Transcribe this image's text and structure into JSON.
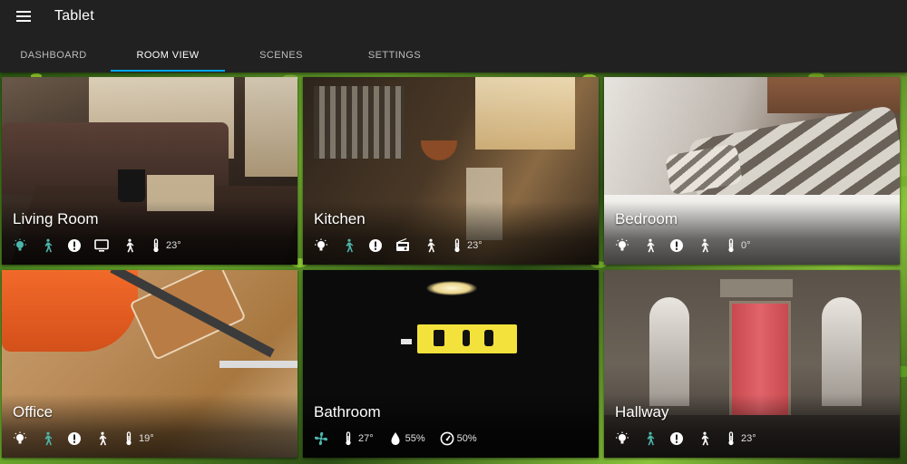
{
  "header": {
    "title": "Tablet",
    "menu_icon": "hamburger-icon"
  },
  "tabs": [
    {
      "label": "DASHBOARD",
      "active": false
    },
    {
      "label": "ROOM VIEW",
      "active": true
    },
    {
      "label": "SCENES",
      "active": false
    },
    {
      "label": "SETTINGS",
      "active": false
    }
  ],
  "colors": {
    "appbar": "#212121",
    "tab_indicator": "#03a9f4",
    "icon_active_teal": "#4db6ac",
    "icon_default": "#ffffff"
  },
  "rooms": [
    {
      "name": "Living Room",
      "indicators": [
        {
          "icon": "light-bulb-icon",
          "active": true
        },
        {
          "icon": "motion-icon",
          "active": true
        },
        {
          "icon": "alert-icon",
          "active": false
        },
        {
          "icon": "tv-icon",
          "active": false
        },
        {
          "icon": "person-walking-icon",
          "active": false
        },
        {
          "icon": "thermometer-icon",
          "active": false,
          "value": "23°"
        }
      ]
    },
    {
      "name": "Kitchen",
      "indicators": [
        {
          "icon": "light-bulb-icon",
          "active": false
        },
        {
          "icon": "motion-icon",
          "active": true
        },
        {
          "icon": "alert-icon",
          "active": false
        },
        {
          "icon": "radio-icon",
          "active": false
        },
        {
          "icon": "person-walking-icon",
          "active": false
        },
        {
          "icon": "thermometer-icon",
          "active": false,
          "value": "23°"
        }
      ]
    },
    {
      "name": "Bedroom",
      "indicators": [
        {
          "icon": "light-bulb-icon",
          "active": false
        },
        {
          "icon": "person-walking-icon",
          "active": false
        },
        {
          "icon": "alert-icon",
          "active": false
        },
        {
          "icon": "person-walking-icon",
          "active": false
        },
        {
          "icon": "thermometer-icon",
          "active": false,
          "value": "0°"
        }
      ]
    },
    {
      "name": "Office",
      "indicators": [
        {
          "icon": "light-bulb-icon",
          "active": false
        },
        {
          "icon": "motion-icon",
          "active": true
        },
        {
          "icon": "alert-icon",
          "active": false
        },
        {
          "icon": "person-walking-icon",
          "active": false
        },
        {
          "icon": "thermometer-icon",
          "active": false,
          "value": "19°"
        }
      ]
    },
    {
      "name": "Bathroom",
      "indicators": [
        {
          "icon": "fan-icon",
          "active": true
        },
        {
          "icon": "thermometer-icon",
          "active": false,
          "value": "27°"
        },
        {
          "icon": "humidity-drop-icon",
          "active": false,
          "value": "55%"
        },
        {
          "icon": "gauge-icon",
          "active": false,
          "value": "50%"
        }
      ]
    },
    {
      "name": "Hallway",
      "indicators": [
        {
          "icon": "light-bulb-icon",
          "active": false
        },
        {
          "icon": "motion-icon",
          "active": true
        },
        {
          "icon": "alert-icon",
          "active": false
        },
        {
          "icon": "person-walking-icon",
          "active": false
        },
        {
          "icon": "thermometer-icon",
          "active": false,
          "value": "23°"
        }
      ]
    }
  ]
}
